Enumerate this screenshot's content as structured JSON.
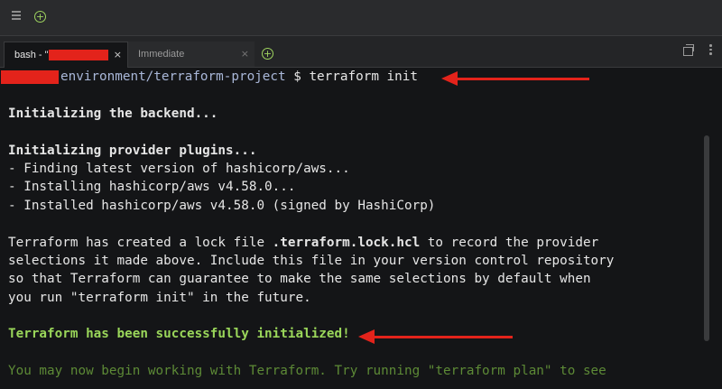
{
  "tabs": [
    {
      "label": "bash - \"",
      "active": true
    },
    {
      "label": "Immediate",
      "active": false
    }
  ],
  "close_glyph": "×",
  "new_glyph": "+",
  "terminal": {
    "prompt_path": "environment/terraform-project",
    "prompt_symbol": " $ ",
    "command": "terraform init",
    "lines": [
      "",
      "Initializing the backend...",
      "",
      "Initializing provider plugins...",
      "- Finding latest version of hashicorp/aws...",
      "- Installing hashicorp/aws v4.58.0...",
      "- Installed hashicorp/aws v4.58.0 (signed by HashiCorp)",
      "",
      "",
      "selections it made above. Include this file in your version control repository",
      "so that Terraform can guarantee to make the same selections by default when",
      "you run \"terraform init\" in the future.",
      "",
      "Terraform has been successfully initialized!",
      "",
      "You may now begin working with Terraform. Try running \"terraform plan\" to see"
    ],
    "lock_line": {
      "before": "Terraform has created a lock file ",
      "file": ".terraform.lock.hcl",
      "after": " to record the provider"
    }
  },
  "colors": {
    "redaction": "#e3231b",
    "success": "#9ad65a",
    "accent_add": "#9fd45f"
  },
  "icons": [
    "menu-icon",
    "add-tab-icon",
    "close-icon",
    "restore-window-icon",
    "more-options-icon"
  ]
}
